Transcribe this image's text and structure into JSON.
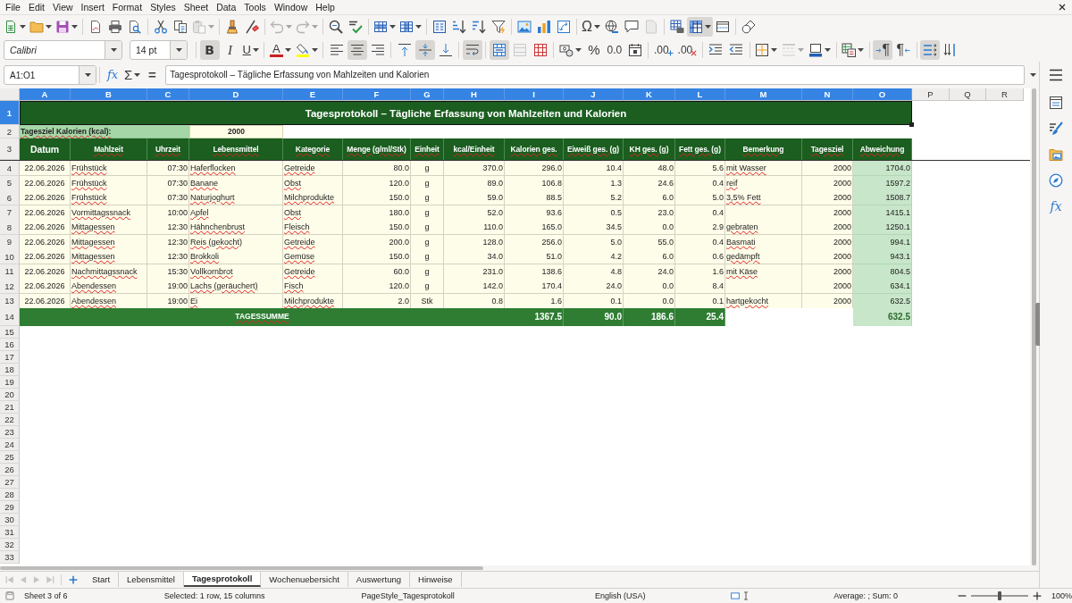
{
  "menu_bar": [
    "File",
    "Edit",
    "View",
    "Insert",
    "Format",
    "Styles",
    "Sheet",
    "Data",
    "Tools",
    "Window",
    "Help"
  ],
  "standard_toolbar": [
    [
      {
        "kind": "new",
        "pressed": false,
        "disabled": false
      },
      {
        "kind": "open",
        "pressed": false,
        "disabled": false
      },
      {
        "kind": "save",
        "pressed": false,
        "disabled": false
      }
    ],
    [
      {
        "kind": "export_pdf",
        "pressed": false,
        "disabled": false
      },
      {
        "kind": "print",
        "pressed": false,
        "disabled": false
      },
      {
        "kind": "print_preview",
        "pressed": false,
        "disabled": false
      }
    ],
    [
      {
        "kind": "cut",
        "pressed": false,
        "disabled": false
      },
      {
        "kind": "copy",
        "pressed": false,
        "disabled": false
      },
      {
        "kind": "paste",
        "pressed": false,
        "disabled": true
      }
    ],
    [
      {
        "kind": "clone_formatting",
        "pressed": false,
        "disabled": false
      },
      {
        "kind": "clear_formatting",
        "pressed": false,
        "disabled": false
      }
    ],
    [
      {
        "kind": "undo",
        "pressed": false,
        "disabled": true
      },
      {
        "kind": "redo",
        "pressed": false,
        "disabled": true
      }
    ],
    [
      {
        "kind": "find_replace",
        "pressed": false,
        "disabled": false
      },
      {
        "kind": "spelling",
        "pressed": false,
        "disabled": false
      }
    ],
    [
      {
        "kind": "rows",
        "pressed": false,
        "disabled": false
      },
      {
        "kind": "columns",
        "pressed": false,
        "disabled": false
      }
    ],
    [
      {
        "kind": "sort",
        "pressed": false,
        "disabled": false
      },
      {
        "kind": "sort_ascending",
        "pressed": false,
        "disabled": false
      },
      {
        "kind": "sort_descending",
        "pressed": false,
        "disabled": false
      },
      {
        "kind": "autofilter",
        "pressed": false,
        "disabled": false
      }
    ],
    [
      {
        "kind": "image",
        "pressed": false,
        "disabled": false
      },
      {
        "kind": "chart",
        "pressed": false,
        "disabled": false
      },
      {
        "kind": "pivot_table",
        "pressed": false,
        "disabled": false
      }
    ],
    [
      {
        "kind": "special_character",
        "glyph": "Ω",
        "pressed": false,
        "disabled": false
      },
      {
        "kind": "hyperlink",
        "pressed": false,
        "disabled": false
      },
      {
        "kind": "comment",
        "pressed": false,
        "disabled": false
      },
      {
        "kind": "header_footer",
        "pressed": false,
        "disabled": true
      }
    ],
    [
      {
        "kind": "print_area",
        "pressed": false,
        "disabled": false
      },
      {
        "kind": "freeze",
        "pressed": true,
        "disabled": false
      },
      {
        "kind": "split_window",
        "pressed": false,
        "disabled": false
      }
    ],
    [
      {
        "kind": "draw_functions",
        "pressed": false,
        "disabled": false
      }
    ]
  ],
  "formatting_toolbar": {
    "font_name": "Calibri",
    "font_size": "14 pt",
    "groups": [
      [
        {
          "kind": "bold",
          "glyph": "B",
          "pressed": true,
          "disabled": false
        },
        {
          "kind": "italic",
          "glyph": "I",
          "pressed": false,
          "disabled": false
        },
        {
          "kind": "underline",
          "glyph": "U",
          "pressed": false,
          "disabled": false
        }
      ],
      [
        {
          "kind": "font_color",
          "glyph": "A",
          "pressed": false,
          "disabled": false
        },
        {
          "kind": "highlighting",
          "pressed": false,
          "disabled": false
        }
      ],
      [
        {
          "kind": "align_left",
          "pressed": false,
          "disabled": false
        },
        {
          "kind": "align_center",
          "pressed": true,
          "disabled": false
        },
        {
          "kind": "align_right",
          "pressed": false,
          "disabled": false
        }
      ],
      [
        {
          "kind": "align_top",
          "pressed": false,
          "disabled": false
        },
        {
          "kind": "align_middle",
          "pressed": true,
          "disabled": false
        },
        {
          "kind": "align_bottom",
          "pressed": false,
          "disabled": false
        }
      ],
      [
        {
          "kind": "wrap_text",
          "pressed": true,
          "disabled": false
        }
      ],
      [
        {
          "kind": "merge_center",
          "pressed": true,
          "disabled": false
        },
        {
          "kind": "merge_cells",
          "pressed": false,
          "disabled": true
        },
        {
          "kind": "unmerge_cells",
          "pressed": false,
          "disabled": false
        }
      ],
      [
        {
          "kind": "currency",
          "pressed": false,
          "disabled": false
        },
        {
          "kind": "percent",
          "glyph": "%",
          "pressed": false,
          "disabled": false
        },
        {
          "kind": "number",
          "glyph": "0.0",
          "pressed": false,
          "disabled": false
        },
        {
          "kind": "date",
          "pressed": false,
          "disabled": false
        }
      ],
      [
        {
          "kind": "add_decimal",
          "glyph": ".00",
          "pressed": false,
          "disabled": false
        },
        {
          "kind": "delete_decimal",
          "glyph": ".00",
          "pressed": false,
          "disabled": false
        }
      ],
      [
        {
          "kind": "indent_increase",
          "pressed": false,
          "disabled": false
        },
        {
          "kind": "indent_decrease",
          "pressed": false,
          "disabled": false
        }
      ],
      [
        {
          "kind": "borders",
          "pressed": false,
          "disabled": false
        },
        {
          "kind": "border_style",
          "pressed": false,
          "disabled": true
        },
        {
          "kind": "border_color",
          "pressed": false,
          "disabled": false
        }
      ],
      [
        {
          "kind": "conditional",
          "pressed": false,
          "disabled": false
        }
      ],
      [
        {
          "kind": "left_to_right",
          "glyph": "¶",
          "pressed": true,
          "disabled": false
        },
        {
          "kind": "right_to_left",
          "glyph": "¶",
          "pressed": false,
          "disabled": false
        }
      ],
      [
        {
          "kind": "text_horizontal",
          "pressed": true,
          "disabled": false
        },
        {
          "kind": "text_vertical",
          "pressed": false,
          "disabled": false
        }
      ]
    ]
  },
  "formula_bar": {
    "name_box": "A1:O1",
    "function_wizard": "fx",
    "sum": "Σ",
    "formula": "=",
    "content": "Tagesprotokoll – Tägliche Erfassung von Mahlzeiten und Kalorien"
  },
  "sheet": {
    "column_headers": [
      {
        "label": "A",
        "selected": true
      },
      {
        "label": "B",
        "selected": true
      },
      {
        "label": "C",
        "selected": true
      },
      {
        "label": "D",
        "selected": true
      },
      {
        "label": "E",
        "selected": true
      },
      {
        "label": "F",
        "selected": true
      },
      {
        "label": "G",
        "selected": true
      },
      {
        "label": "H",
        "selected": true
      },
      {
        "label": "I",
        "selected": true
      },
      {
        "label": "J",
        "selected": true
      },
      {
        "label": "K",
        "selected": true
      },
      {
        "label": "L",
        "selected": true
      },
      {
        "label": "M",
        "selected": true
      },
      {
        "label": "N",
        "selected": true
      },
      {
        "label": "O",
        "selected": true
      },
      {
        "label": "P",
        "selected": false
      },
      {
        "label": "Q",
        "selected": false
      },
      {
        "label": "R",
        "selected": false
      }
    ],
    "row_headers": [
      {
        "label": "1",
        "selected": true
      },
      {
        "label": "2",
        "selected": false
      },
      {
        "label": "3",
        "selected": false
      },
      {
        "label": "4",
        "selected": false
      },
      {
        "label": "5",
        "selected": false
      },
      {
        "label": "6",
        "selected": false
      },
      {
        "label": "7",
        "selected": false
      },
      {
        "label": "8",
        "selected": false
      },
      {
        "label": "9",
        "selected": false
      },
      {
        "label": "10",
        "selected": false
      },
      {
        "label": "11",
        "selected": false
      },
      {
        "label": "12",
        "selected": false
      },
      {
        "label": "13",
        "selected": false
      },
      {
        "label": "14",
        "selected": false
      },
      {
        "label": "15",
        "selected": false
      },
      {
        "label": "16",
        "selected": false
      },
      {
        "label": "17",
        "selected": false
      },
      {
        "label": "18",
        "selected": false
      },
      {
        "label": "19",
        "selected": false
      },
      {
        "label": "20",
        "selected": false
      },
      {
        "label": "21",
        "selected": false
      },
      {
        "label": "22",
        "selected": false
      },
      {
        "label": "23",
        "selected": false
      },
      {
        "label": "24",
        "selected": false
      },
      {
        "label": "25",
        "selected": false
      },
      {
        "label": "26",
        "selected": false
      },
      {
        "label": "27",
        "selected": false
      },
      {
        "label": "28",
        "selected": false
      },
      {
        "label": "29",
        "selected": false
      },
      {
        "label": "30",
        "selected": false
      },
      {
        "label": "31",
        "selected": false
      },
      {
        "label": "32",
        "selected": false
      },
      {
        "label": "33",
        "selected": false
      }
    ],
    "title": {
      "text": "Tagesprotokoll – Tägliche Erfassung von Mahlzeiten und Kalorien",
      "selected": true
    },
    "goal_label": "Tagesziel Kalorien (kcal):",
    "goal_value": "2000",
    "table_headers": [
      "Datum",
      "Mahlzeit",
      "Uhrzeit",
      "Lebensmittel",
      "Kategorie",
      "Menge (g/ml/Stk)",
      "Einheit",
      "kcal/Einheit",
      "Kalorien ges.",
      "Eiweiß ges. (g)",
      "KH ges. (g)",
      "Fett ges. (g)",
      "Bemerkung",
      "Tagesziel",
      "Abweichung"
    ],
    "rows": [
      {
        "date": "22.06.2026",
        "meal": "Frühstück",
        "time": "07:30",
        "food": "Haferflocken",
        "category": "Getreide",
        "amount": "80.0",
        "unit": "g",
        "kcal_per_unit": "370.0",
        "calories": "296.0",
        "protein": "10.4",
        "carbs": "48.0",
        "fat": "5.6",
        "note": "mit Wasser",
        "goal": "2000",
        "deviation": "1704.0"
      },
      {
        "date": "22.06.2026",
        "meal": "Frühstück",
        "time": "07:30",
        "food": "Banane",
        "category": "Obst",
        "amount": "120.0",
        "unit": "g",
        "kcal_per_unit": "89.0",
        "calories": "106.8",
        "protein": "1.3",
        "carbs": "24.6",
        "fat": "0.4",
        "note": "reif",
        "goal": "2000",
        "deviation": "1597.2"
      },
      {
        "date": "22.06.2026",
        "meal": "Frühstück",
        "time": "07:30",
        "food": "Naturjoghurt",
        "category": "Milchprodukte",
        "amount": "150.0",
        "unit": "g",
        "kcal_per_unit": "59.0",
        "calories": "88.5",
        "protein": "5.2",
        "carbs": "6.0",
        "fat": "5.0",
        "note": "3,5% Fett",
        "goal": "2000",
        "deviation": "1508.7"
      },
      {
        "date": "22.06.2026",
        "meal": "Vormittagssnack",
        "time": "10:00",
        "food": "Apfel",
        "category": "Obst",
        "amount": "180.0",
        "unit": "g",
        "kcal_per_unit": "52.0",
        "calories": "93.6",
        "protein": "0.5",
        "carbs": "23.0",
        "fat": "0.4",
        "goal": "2000",
        "deviation": "1415.1"
      },
      {
        "date": "22.06.2026",
        "meal": "Mittagessen",
        "time": "12:30",
        "food": "Hähnchenbrust",
        "category": "Fleisch",
        "amount": "150.0",
        "unit": "g",
        "kcal_per_unit": "110.0",
        "calories": "165.0",
        "protein": "34.5",
        "carbs": "0.0",
        "fat": "2.9",
        "note": "gebraten",
        "goal": "2000",
        "deviation": "1250.1"
      },
      {
        "date": "22.06.2026",
        "meal": "Mittagessen",
        "time": "12:30",
        "food": "Reis (gekocht)",
        "category": "Getreide",
        "amount": "200.0",
        "unit": "g",
        "kcal_per_unit": "128.0",
        "calories": "256.0",
        "protein": "5.0",
        "carbs": "55.0",
        "fat": "0.4",
        "note": "Basmati",
        "goal": "2000",
        "deviation": "994.1"
      },
      {
        "date": "22.06.2026",
        "meal": "Mittagessen",
        "time": "12:30",
        "food": "Brokkoli",
        "category": "Gemüse",
        "amount": "150.0",
        "unit": "g",
        "kcal_per_unit": "34.0",
        "calories": "51.0",
        "protein": "4.2",
        "carbs": "6.0",
        "fat": "0.6",
        "note": "gedämpft",
        "goal": "2000",
        "deviation": "943.1"
      },
      {
        "date": "22.06.2026",
        "meal": "Nachmittagssnack",
        "time": "15:30",
        "food": "Vollkornbrot",
        "category": "Getreide",
        "amount": "60.0",
        "unit": "g",
        "kcal_per_unit": "231.0",
        "calories": "138.6",
        "protein": "4.8",
        "carbs": "24.0",
        "fat": "1.6",
        "note": "mit Käse",
        "goal": "2000",
        "deviation": "804.5"
      },
      {
        "date": "22.06.2026",
        "meal": "Abendessen",
        "time": "19:00",
        "food": "Lachs (geräuchert)",
        "category": "Fisch",
        "amount": "120.0",
        "unit": "g",
        "kcal_per_unit": "142.0",
        "calories": "170.4",
        "protein": "24.0",
        "carbs": "0.0",
        "fat": "8.4",
        "goal": "2000",
        "deviation": "634.1"
      },
      {
        "date": "22.06.2026",
        "meal": "Abendessen",
        "time": "19:00",
        "food": "Ei",
        "category": "Milchprodukte",
        "amount": "2.0",
        "unit": "Stk",
        "kcal_per_unit": "0.8",
        "calories": "1.6",
        "protein": "0.1",
        "carbs": "0.0",
        "fat": "0.1",
        "note": "hartgekocht",
        "goal": "2000",
        "deviation": "632.5"
      }
    ],
    "total": {
      "label": "TAGESSUMME",
      "calories": "1367.5",
      "protein": "90.0",
      "carbs": "186.6",
      "fat": "25.4",
      "deviation": "632.5"
    },
    "spelling_marks": true,
    "freeze_line": true
  },
  "sidebar": [
    {
      "kind": "properties",
      "selected": false
    },
    {
      "kind": "styles",
      "selected": false
    },
    {
      "kind": "gallery",
      "selected": false
    },
    {
      "kind": "navigator",
      "selected": false
    },
    {
      "kind": "functions",
      "glyph": "fx",
      "selected": false
    }
  ],
  "sheet_tabs": {
    "scroll_buttons": [
      {
        "kind": "first",
        "disabled": true
      },
      {
        "kind": "previous",
        "disabled": true
      },
      {
        "kind": "next",
        "disabled": true
      },
      {
        "kind": "last",
        "disabled": true
      }
    ],
    "tabs": [
      {
        "label": "Start",
        "selected": false
      },
      {
        "label": "Lebensmittel",
        "selected": false
      },
      {
        "label": "Tagesprotokoll",
        "selected": true
      },
      {
        "label": "Wochenuebersicht",
        "selected": false
      },
      {
        "label": "Auswertung",
        "selected": false
      },
      {
        "label": "Hinweise",
        "selected": false
      }
    ]
  },
  "status_bar": {
    "sheet_position": "Sheet 3 of 6",
    "selection": "Selected: 1 row, 15 columns",
    "page_style": "PageStyle_Tagesprotokoll",
    "language": "English (USA)",
    "summary": "Average: ; Sum: 0",
    "zoom": {
      "level": 0.5,
      "reading": "100%"
    }
  }
}
